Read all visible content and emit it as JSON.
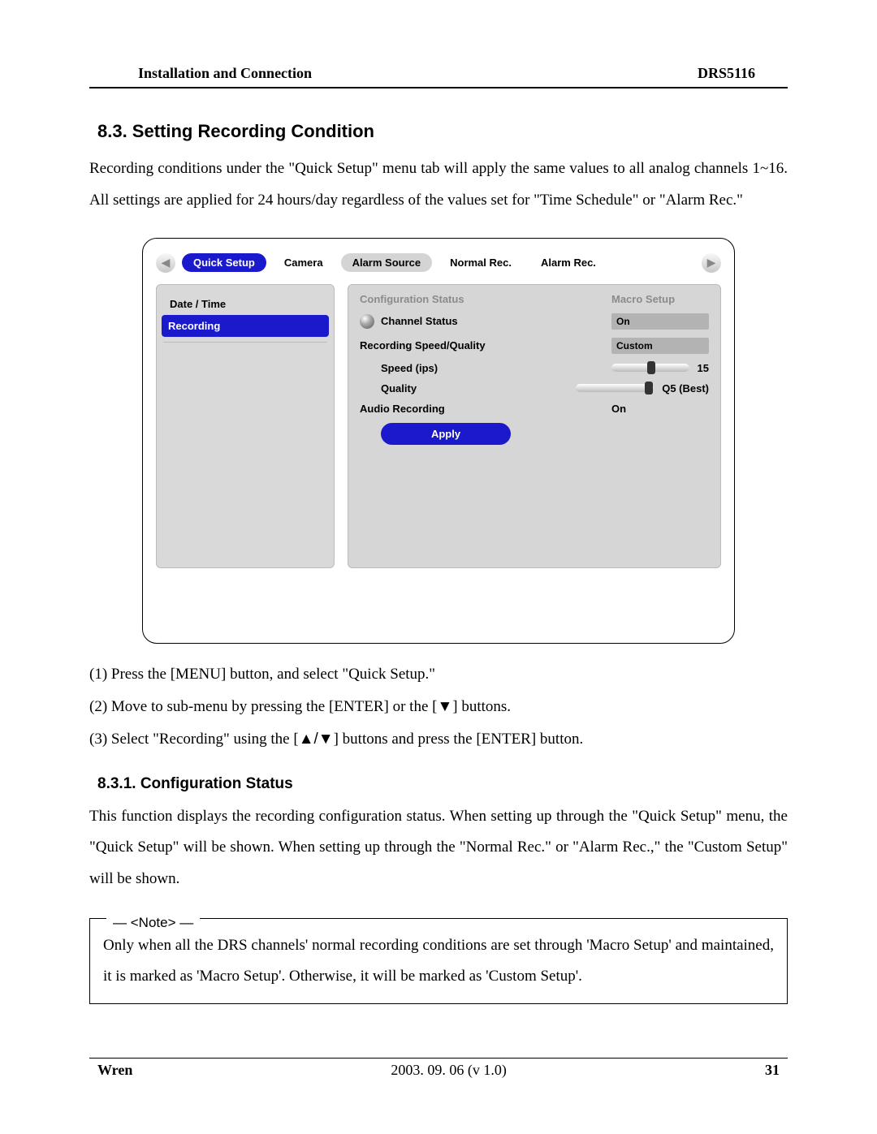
{
  "header": {
    "left": "Installation and Connection",
    "right": "DRS5116"
  },
  "section": {
    "num_title": "8.3.  Setting Recording Condition",
    "intro": "Recording conditions under the \"Quick Setup\" menu tab will apply the same values to all analog channels 1~16.   All settings are applied for 24 hours/day regardless of the values set for \"Time Schedule\" or \"Alarm Rec.\""
  },
  "ui": {
    "tabs": [
      "Quick Setup",
      "Camera",
      "Alarm Source",
      "Normal Rec.",
      "Alarm Rec."
    ],
    "sidebar": [
      "Date / Time",
      "Recording"
    ],
    "labels": {
      "config_status": "Configuration Status",
      "macro_setup": "Macro Setup",
      "channel_status": "Channel Status",
      "rs_quality": "Recording Speed/Quality",
      "speed": "Speed (ips)",
      "quality": "Quality",
      "audio": "Audio Recording",
      "apply": "Apply"
    },
    "values": {
      "channel_status": "On",
      "rs_quality": "Custom",
      "speed": "15",
      "quality": "Q5 (Best)",
      "audio": "On"
    },
    "slider": {
      "speed_pos_pct": 46,
      "quality_pos_pct": 88
    }
  },
  "steps": {
    "s1": "(1)  Press the [MENU] button, and select \"Quick Setup.\"",
    "s2a": "(2)  Move to sub-menu by pressing the [ENTER] or the [",
    "s2b": "] buttons.",
    "s3a": "(3)  Select \"Recording\" using the [",
    "s3b": "] buttons and press the [ENTER] button."
  },
  "subsection": {
    "title": "8.3.1.  Configuration Status",
    "body": "This function displays the recording configuration status.   When setting up through the \"Quick Setup\" menu, the \"Quick Setup\" will be shown.   When setting up through the \"Normal Rec.\" or \"Alarm Rec.,\" the \"Custom Setup\" will be shown."
  },
  "note": {
    "legend": "<Note>",
    "body": "Only when all the DRS channels' normal recording conditions are set through 'Macro Setup' and maintained, it is marked as 'Macro Setup'.   Otherwise, it will be marked as 'Custom Setup'."
  },
  "footer": {
    "left": "Wren",
    "mid": "2003. 09. 06 (v 1.0)",
    "right": "31"
  },
  "glyph": {
    "down": "▼",
    "updown": "▲/▼",
    "left_arrow": "◀",
    "right_arrow": "▶"
  }
}
